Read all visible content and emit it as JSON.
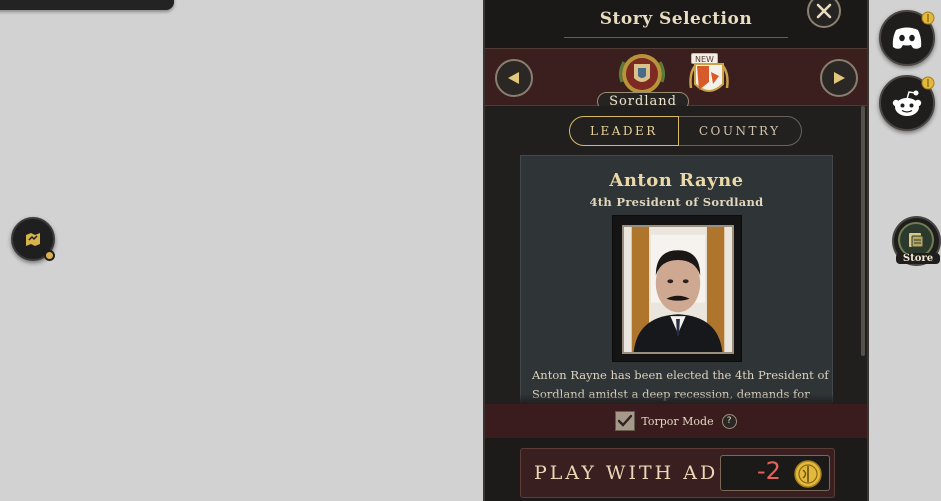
{
  "panel": {
    "title": "Story Selection",
    "close_icon": "close-icon"
  },
  "selector": {
    "country": "Sordland",
    "new_badge": "NEW",
    "prev_icon": "triangle-left-icon",
    "next_icon": "triangle-right-icon"
  },
  "tabs": [
    {
      "label": "LEADER",
      "active": true
    },
    {
      "label": "COUNTRY",
      "active": false
    }
  ],
  "leader": {
    "name": "Anton Rayne",
    "title": "4th President of Sordland",
    "description": "Anton Rayne has been elected the 4th President of Sordland amidst a deep recession, demands for"
  },
  "torpor": {
    "label": "Torpor Mode",
    "checked": true,
    "help": "?"
  },
  "play": {
    "label": "PLAY WITH ADS",
    "cost": "-2",
    "cost_color": "#e0645a"
  },
  "sidebar": {
    "discord_icon": "discord-icon",
    "reddit_icon": "reddit-icon",
    "store_label": "Store"
  }
}
